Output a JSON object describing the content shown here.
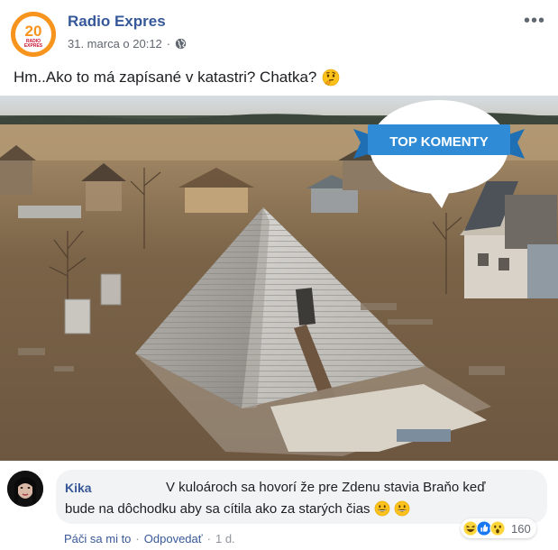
{
  "post": {
    "page_name": "Radio Expres",
    "date": "31. marca o 20:12",
    "separator": "·",
    "text": "Hm..Ako to má zapísané v katastri? Chatka?",
    "logo_number": "20",
    "logo_text_1": "RADIO",
    "logo_text_2": "EXPRES",
    "more_label": "•••"
  },
  "photo": {
    "badge_text": "TOP KOMENTY"
  },
  "comment": {
    "author": "Kika",
    "text_line1": "V kuloároch sa hovorí že pre Zdenu stavia Braňo keď",
    "text_line2": "bude na dôchodku aby sa cítila ako za starých čias",
    "reaction_count": "160",
    "like_label": "Páči sa mi to",
    "reply_label": "Odpovedať",
    "time": "1 d.",
    "separator": "·"
  },
  "colors": {
    "page_name": "#365899",
    "link": "#385898",
    "logo": "#f7941d",
    "badge": "#2f8bd6",
    "bubble": "#f2f3f5"
  },
  "icons": [
    "globe-icon",
    "more-options-icon",
    "thinking-face-icon",
    "grinning-face-icon",
    "laugh-reaction-icon",
    "like-reaction-icon",
    "wow-reaction-icon"
  ]
}
